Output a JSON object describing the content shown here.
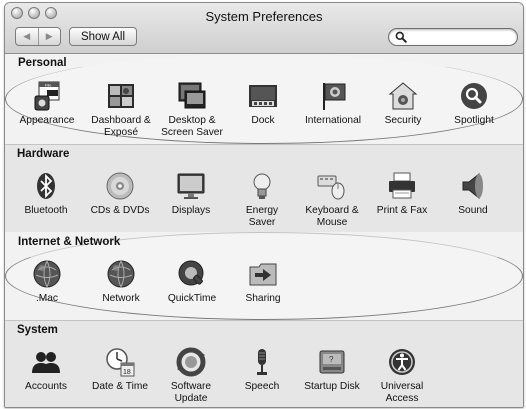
{
  "window": {
    "title": "System Preferences",
    "back_label": "◀",
    "forward_label": "▶",
    "show_all_label": "Show All",
    "search_value": ""
  },
  "sections": [
    {
      "title": "Personal",
      "panes": [
        {
          "label": "Appearance",
          "icon": "appearance-icon"
        },
        {
          "label": "Dashboard &\nExposé",
          "icon": "dashboard-expose-icon"
        },
        {
          "label": "Desktop &\nScreen Saver",
          "icon": "desktop-screensaver-icon"
        },
        {
          "label": "Dock",
          "icon": "dock-icon"
        },
        {
          "label": "International",
          "icon": "international-icon"
        },
        {
          "label": "Security",
          "icon": "security-icon"
        },
        {
          "label": "Spotlight",
          "icon": "spotlight-icon"
        }
      ]
    },
    {
      "title": "Hardware",
      "panes": [
        {
          "label": "Bluetooth",
          "icon": "bluetooth-icon"
        },
        {
          "label": "CDs & DVDs",
          "icon": "cds-dvds-icon"
        },
        {
          "label": "Displays",
          "icon": "displays-icon"
        },
        {
          "label": "Energy\nSaver",
          "icon": "energy-saver-icon"
        },
        {
          "label": "Keyboard &\nMouse",
          "icon": "keyboard-mouse-icon"
        },
        {
          "label": "Print & Fax",
          "icon": "print-fax-icon"
        },
        {
          "label": "Sound",
          "icon": "sound-icon"
        }
      ]
    },
    {
      "title": "Internet & Network",
      "panes": [
        {
          "label": ".Mac",
          "icon": "dotmac-icon"
        },
        {
          "label": "Network",
          "icon": "network-icon"
        },
        {
          "label": "QuickTime",
          "icon": "quicktime-icon"
        },
        {
          "label": "Sharing",
          "icon": "sharing-icon"
        }
      ]
    },
    {
      "title": "System",
      "panes": [
        {
          "label": "Accounts",
          "icon": "accounts-icon"
        },
        {
          "label": "Date & Time",
          "icon": "date-time-icon"
        },
        {
          "label": "Software\nUpdate",
          "icon": "software-update-icon"
        },
        {
          "label": "Speech",
          "icon": "speech-icon"
        },
        {
          "label": "Startup Disk",
          "icon": "startup-disk-icon"
        },
        {
          "label": "Universal\nAccess",
          "icon": "universal-access-icon"
        }
      ]
    }
  ],
  "date_time_icon_day": "18"
}
